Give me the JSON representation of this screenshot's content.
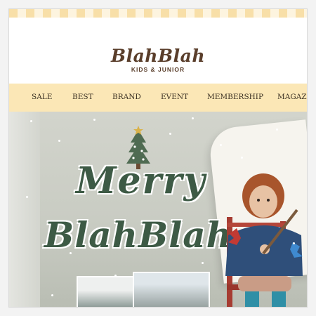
{
  "brand": {
    "name": "BlahBlah",
    "tagline": "KIDS & JUNIOR"
  },
  "nav": {
    "items": [
      {
        "label": "SALE"
      },
      {
        "label": "BEST"
      },
      {
        "label": "BRAND"
      },
      {
        "label": "EVENT"
      },
      {
        "label": "MEMBERSHIP"
      },
      {
        "label": "MAGAZI"
      }
    ]
  },
  "banner": {
    "line1": "Merry",
    "line2": "BlahBlah"
  },
  "colors": {
    "nav_bg": "#fbe7b6",
    "logo_brown": "#5a3e2b",
    "script_green": "#3d5a45"
  }
}
